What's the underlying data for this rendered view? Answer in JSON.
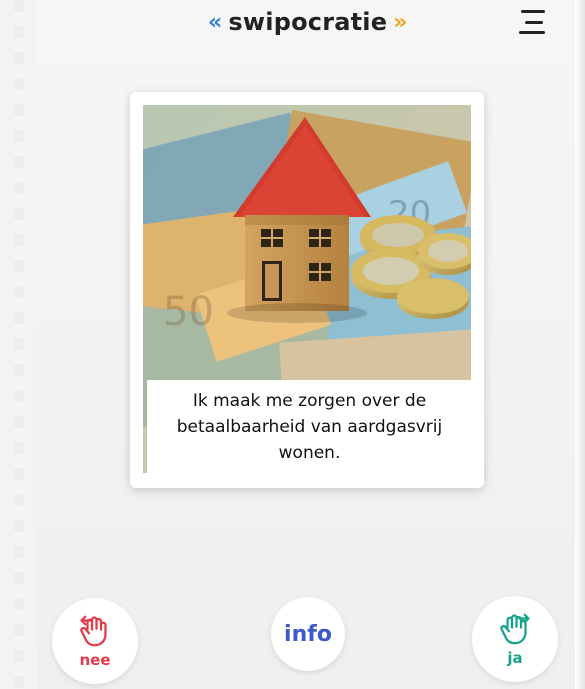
{
  "header": {
    "brand_left": "«",
    "brand_name": "swipocratie",
    "brand_right": "»"
  },
  "card": {
    "image_alt": "house-and-money-photo",
    "statement": "Ik maak me zorgen over de betaalbaarheid van aardgasvrij wonen."
  },
  "actions": {
    "no_label": "nee",
    "info_label": "info",
    "yes_label": "ja"
  },
  "icons": {
    "menu": "menu-icon",
    "no": "hand-swipe-left-icon",
    "yes": "hand-swipe-right-icon"
  },
  "colors": {
    "brand_left_quote": "#2f7fd8",
    "brand_right_quote": "#f2a41d",
    "no": "#e33b4a",
    "yes": "#17a38b",
    "info": "#3f58c8"
  }
}
